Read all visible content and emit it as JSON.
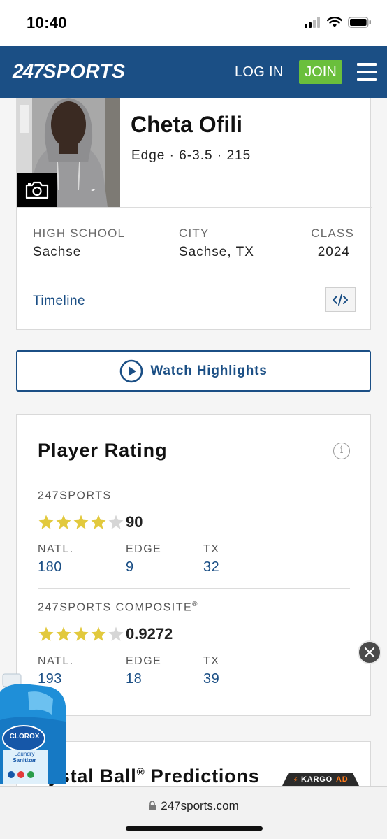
{
  "status_bar": {
    "time": "10:40"
  },
  "header": {
    "logo": {
      "num": "247",
      "word": "SPORTS"
    },
    "login_label": "LOG IN",
    "join_label": "JOIN"
  },
  "player": {
    "name": "Cheta Ofili",
    "meta": "Edge · 6-3.5 · 215",
    "high_school_label": "HIGH SCHOOL",
    "high_school": "Sachse",
    "city_label": "CITY",
    "city": "Sachse, TX",
    "class_label": "CLASS",
    "class": "2024",
    "timeline_label": "Timeline"
  },
  "watch_label": "Watch Highlights",
  "rating": {
    "title": "Player Rating",
    "info_icon": "i",
    "sources": [
      {
        "name": "247SPORTS",
        "registered": "",
        "stars": 4,
        "score": "90",
        "ranks": [
          {
            "label": "NATL.",
            "value": "180"
          },
          {
            "label": "EDGE",
            "value": "9"
          },
          {
            "label": "TX",
            "value": "32"
          }
        ]
      },
      {
        "name": "247SPORTS COMPOSITE",
        "registered": "®",
        "stars": 4,
        "score": "0.9272",
        "ranks": [
          {
            "label": "NATL.",
            "value": "193"
          },
          {
            "label": "EDGE",
            "value": "18"
          },
          {
            "label": "TX",
            "value": "39"
          }
        ]
      }
    ]
  },
  "crystal_ball": {
    "title": "ystal Ball",
    "registered": "®",
    "suffix": " Predictions"
  },
  "ad": {
    "brand": "CLOROX",
    "product_line1": "Laundry",
    "product_line2": "Sanitizer",
    "kargo_label": "KARGO",
    "kargo_ad": "AD"
  },
  "url": "247sports.com",
  "colors": {
    "brand_blue": "#1b4f85",
    "join_green": "#6abf3c",
    "star_gold": "#e2c93d",
    "star_empty": "#d6d6d6"
  }
}
